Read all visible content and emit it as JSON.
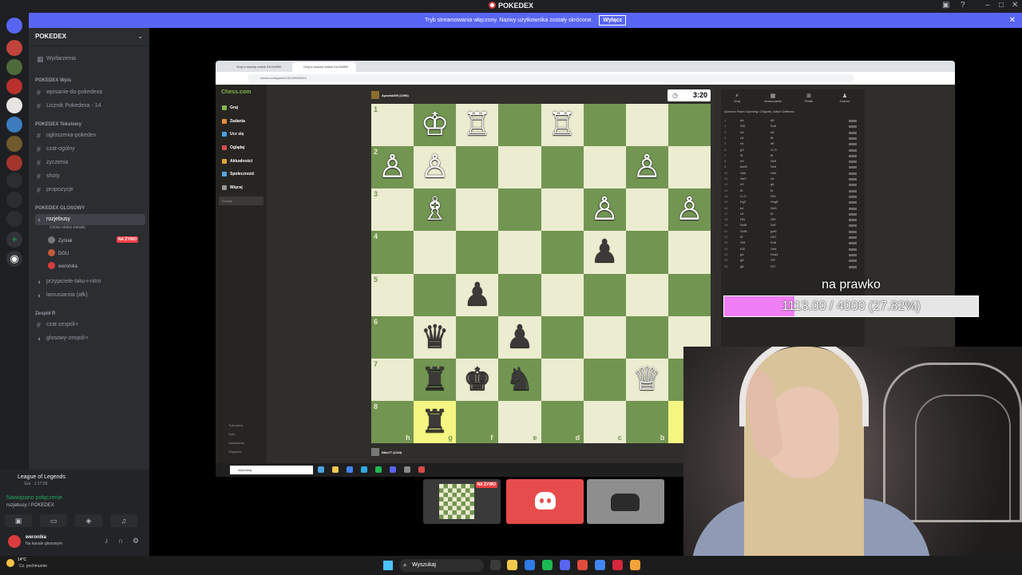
{
  "discord": {
    "title": "POKEDEX",
    "banner_text": "Tryb streamowania włączony. Nazwy użytkownika zostały skrócone.",
    "banner_button": "Wyłącz",
    "server_name": "POKEDEX",
    "channels": [
      {
        "label": "Wydarzenia",
        "type": "events"
      },
      {
        "label": "POKEDEX Wpis",
        "type": "category"
      },
      {
        "label": "wpisanie-do-pokedexa",
        "type": "text"
      },
      {
        "label": "Licznik Pokedexa - 14",
        "type": "text"
      },
      {
        "label": "POKEDEX Tekstowy",
        "type": "category"
      },
      {
        "label": "ogloszenia-pokedex",
        "type": "text"
      },
      {
        "label": "czat-ogólny",
        "type": "text"
      },
      {
        "label": "życzenia",
        "type": "text"
      },
      {
        "label": "shoty",
        "type": "text"
      },
      {
        "label": "propozycje",
        "type": "text"
      },
      {
        "label": "POKEDEX GLOSOWY",
        "type": "category"
      },
      {
        "label": "rozjebusy",
        "type": "voice"
      },
      {
        "label": "przyjaciele-taku-i-nitro",
        "type": "voice"
      },
      {
        "label": "lamusiarnia (afk)",
        "type": "voice"
      },
      {
        "label": "Zespół R",
        "type": "category"
      },
      {
        "label": "czat-zespół-r",
        "type": "text"
      },
      {
        "label": "glosowy-zespół-r",
        "type": "voice"
      }
    ],
    "voice_status": "Ustaw status kanału",
    "voice_users": [
      "Zyniak",
      "DGU",
      "weronika"
    ],
    "live_badge": "NA ŻYWO",
    "activity": {
      "game": "League of Legends",
      "detail": "Gra · 1:17:03"
    },
    "connection": {
      "status": "Nawiązano połączenie",
      "channel": "rozjebusy / POKEDEX"
    },
    "user": {
      "name": "weronika",
      "status": "Na kanale głosowym"
    }
  },
  "browser": {
    "tabs": [
      "Graj w szachy online ZA DARM",
      "Graj w szachy online ZA DARM"
    ],
    "url": "chess.com/game/141139663624"
  },
  "chesscom": {
    "logo": "Chess.com",
    "nav": [
      "Graj",
      "Zadania",
      "Ucz się",
      "Oglądaj",
      "Aktualności",
      "Społeczność",
      "Więcej"
    ],
    "search_placeholder": "Szukaj",
    "footer": [
      "Tryb jasny",
      "Zwiń",
      "Ustawienia",
      "Wsparcie"
    ],
    "top_player": "Ayusha390 (1090)",
    "bottom_player": "Niko77 (1110)",
    "clock": "3:20",
    "panel_tabs": [
      "Graj",
      "Nowa partia",
      "Partie",
      "Gracze"
    ],
    "opening": "Queen's Pawn Opening: Chigorin, Alburt Defense",
    "moves": [
      {
        "n": "1.",
        "w": "d4",
        "b": "d5"
      },
      {
        "n": "2.",
        "w": "Sf3",
        "b": "Sc6"
      },
      {
        "n": "3.",
        "w": "e3",
        "b": "e6"
      },
      {
        "n": "4.",
        "w": "c3",
        "b": "f6"
      },
      {
        "n": "5.",
        "w": "e4",
        "b": "d6"
      },
      {
        "n": "6.",
        "w": "g3",
        "b": "O-O"
      },
      {
        "n": "7.",
        "w": "f3",
        "b": "f5"
      },
      {
        "n": "8.",
        "w": "e5",
        "b": "Se5"
      },
      {
        "n": "9.",
        "w": "dxe5",
        "b": "Se4"
      },
      {
        "n": "10.",
        "w": "Sd4",
        "b": "Hd4"
      },
      {
        "n": "11.",
        "w": "Ge2",
        "b": "c5"
      },
      {
        "n": "12.",
        "w": "h3",
        "b": "g6"
      },
      {
        "n": "13.",
        "w": "f5",
        "b": "f4"
      },
      {
        "n": "14.",
        "w": "O-O",
        "b": "Gf4"
      },
      {
        "n": "15.",
        "w": "Kg2",
        "b": "Hxg8"
      },
      {
        "n": "16.",
        "w": "b4",
        "b": "Ge5"
      },
      {
        "n": "17.",
        "w": "c3",
        "b": "f3"
      },
      {
        "n": "18.",
        "w": "Hf1",
        "b": "Gf3"
      },
      {
        "n": "19.",
        "w": "Sxf6",
        "b": "Sd7"
      },
      {
        "n": "20.",
        "w": "Gxf6",
        "b": "gxf6"
      },
      {
        "n": "21.",
        "w": "f5",
        "b": "Hh7"
      },
      {
        "n": "22.",
        "w": "Gf4",
        "b": "Kh8"
      },
      {
        "n": "23.",
        "w": "Kf2",
        "b": "Gd4"
      },
      {
        "n": "24.",
        "w": "g4",
        "b": "Hxd4"
      },
      {
        "n": "25.",
        "w": "g5",
        "b": "Sf7"
      },
      {
        "n": "26.",
        "w": "g8",
        "b": "Gf7"
      }
    ],
    "ranks": [
      "1",
      "2",
      "3",
      "4",
      "5",
      "6",
      "7",
      "8"
    ],
    "files": [
      "h",
      "g",
      "f",
      "e",
      "d",
      "c",
      "b",
      "a"
    ],
    "pieces": [
      {
        "sq": [
          0,
          1
        ],
        "p": "♔",
        "c": "w"
      },
      {
        "sq": [
          0,
          2
        ],
        "p": "♖",
        "c": "w"
      },
      {
        "sq": [
          0,
          4
        ],
        "p": "♖",
        "c": "w"
      },
      {
        "sq": [
          1,
          0
        ],
        "p": "♙",
        "c": "w"
      },
      {
        "sq": [
          1,
          1
        ],
        "p": "♙",
        "c": "w"
      },
      {
        "sq": [
          1,
          6
        ],
        "p": "♙",
        "c": "w"
      },
      {
        "sq": [
          2,
          1
        ],
        "p": "♗",
        "c": "w"
      },
      {
        "sq": [
          2,
          5
        ],
        "p": "♙",
        "c": "w"
      },
      {
        "sq": [
          2,
          7
        ],
        "p": "♙",
        "c": "w"
      },
      {
        "sq": [
          3,
          5
        ],
        "p": "♟",
        "c": "b"
      },
      {
        "sq": [
          4,
          2
        ],
        "p": "♟",
        "c": "b"
      },
      {
        "sq": [
          5,
          1
        ],
        "p": "♛",
        "c": "b"
      },
      {
        "sq": [
          5,
          3
        ],
        "p": "♟",
        "c": "b"
      },
      {
        "sq": [
          6,
          1
        ],
        "p": "♜",
        "c": "b"
      },
      {
        "sq": [
          6,
          2
        ],
        "p": "♚",
        "c": "b"
      },
      {
        "sq": [
          6,
          3
        ],
        "p": "♞",
        "c": "b"
      },
      {
        "sq": [
          6,
          6
        ],
        "p": "♕",
        "c": "w"
      },
      {
        "sq": [
          7,
          1
        ],
        "p": "♜",
        "c": "b"
      }
    ],
    "highlighted": [
      [
        7,
        1
      ],
      [
        7,
        7
      ]
    ]
  },
  "goal": {
    "label": "na prawko",
    "text": "1113.00 / 4000 (27.82%)",
    "current": 1113.0,
    "target": 4000,
    "fill_color": "#f07ef5"
  },
  "inner_taskbar": {
    "search": "Wyszukaj"
  },
  "taskbar": {
    "weather_temp": "14°C",
    "weather_desc": "Cz. pochmurnie",
    "search": "Wyszukaj"
  },
  "colors": {
    "discord_blurple": "#5865f2",
    "chess_dark": "#739552",
    "chess_light": "#ebecd0",
    "live_red": "#f23f43"
  }
}
